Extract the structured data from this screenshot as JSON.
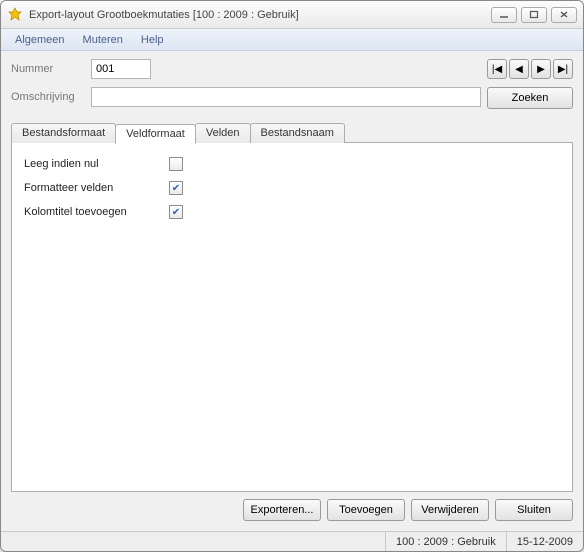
{
  "window": {
    "title": "Export-layout Grootboekmutaties  [100 : 2009 : Gebruik]"
  },
  "menu": {
    "algemeen": "Algemeen",
    "muteren": "Muteren",
    "help": "Help"
  },
  "fields": {
    "nummer_label": "Nummer",
    "nummer_value": "001",
    "omschrijving_label": "Omschrijving",
    "omschrijving_value": "",
    "zoeken": "Zoeken"
  },
  "nav": {
    "first": "|◀",
    "prev": "◀",
    "next": "▶",
    "last": "▶|"
  },
  "tabs": {
    "bestandsformaat": "Bestandsformaat",
    "veldformaat": "Veldformaat",
    "velden": "Velden",
    "bestandsnaam": "Bestandsnaam"
  },
  "options": {
    "leeg_label": "Leeg indien nul",
    "leeg_checked": false,
    "formatteer_label": "Formatteer velden",
    "formatteer_checked": true,
    "kolomtitel_label": "Kolomtitel toevoegen",
    "kolomtitel_checked": true
  },
  "buttons": {
    "exporteren": "Exporteren...",
    "toevoegen": "Toevoegen",
    "verwijderen": "Verwijderen",
    "sluiten": "Sluiten"
  },
  "status": {
    "context": "100 : 2009 : Gebruik",
    "date": "15-12-2009"
  }
}
